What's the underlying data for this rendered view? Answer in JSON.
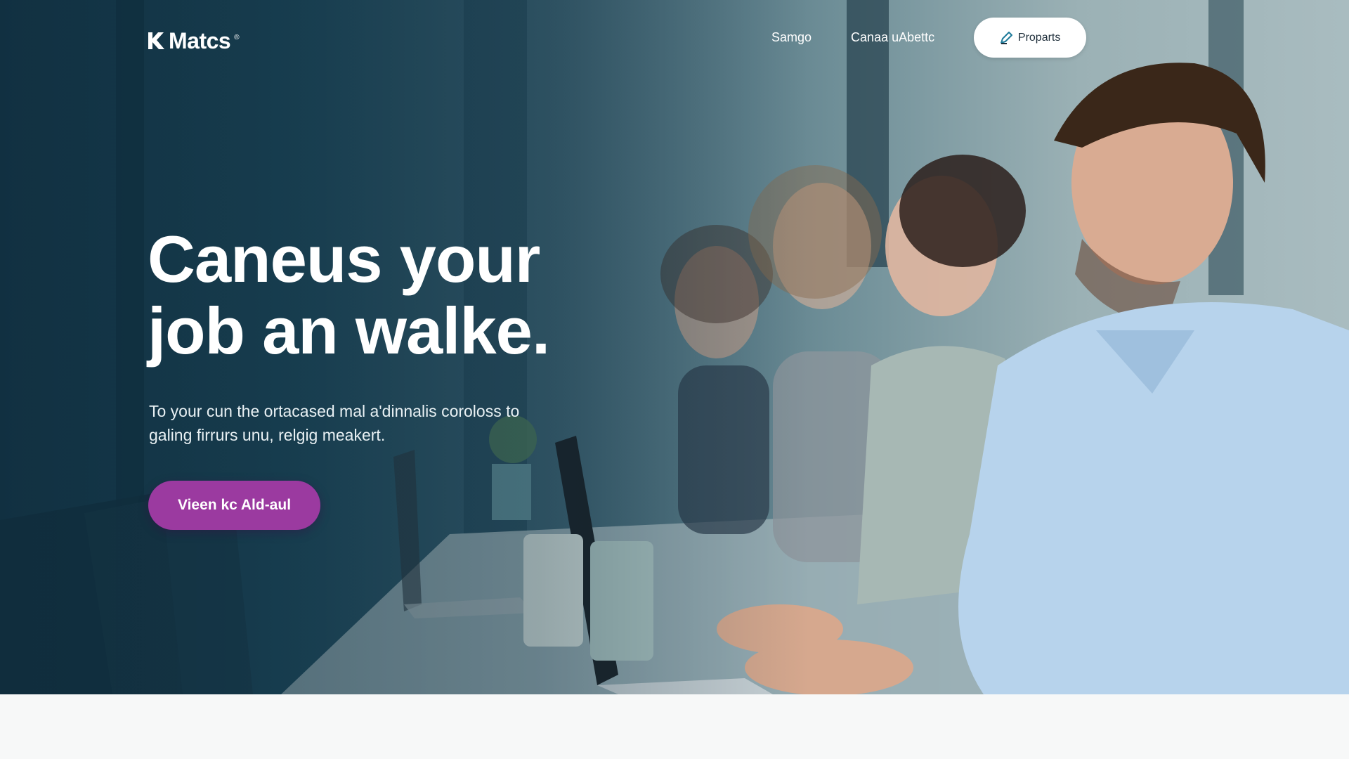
{
  "brand": {
    "name": "Matcs",
    "registered_mark": "®"
  },
  "nav": {
    "links": [
      "Samgo",
      "Canaa uAbettc"
    ],
    "cta_label": "Proparts",
    "cta_icon": "pencil-icon"
  },
  "hero": {
    "headline_line1": "Caneus your",
    "headline_line2": "job an walke.",
    "subtext_line1": "To your cun the ortacased mal a'dinnalis coroloss to",
    "subtext_line2": "galing firrurs unu, relgig meakert.",
    "button_label": "Vieen kc Ald-aul"
  },
  "colors": {
    "accent": "#9b3aa0",
    "hero_dark": "#17384a",
    "text_light": "#ffffff",
    "page_bg": "#f7f8f8"
  }
}
